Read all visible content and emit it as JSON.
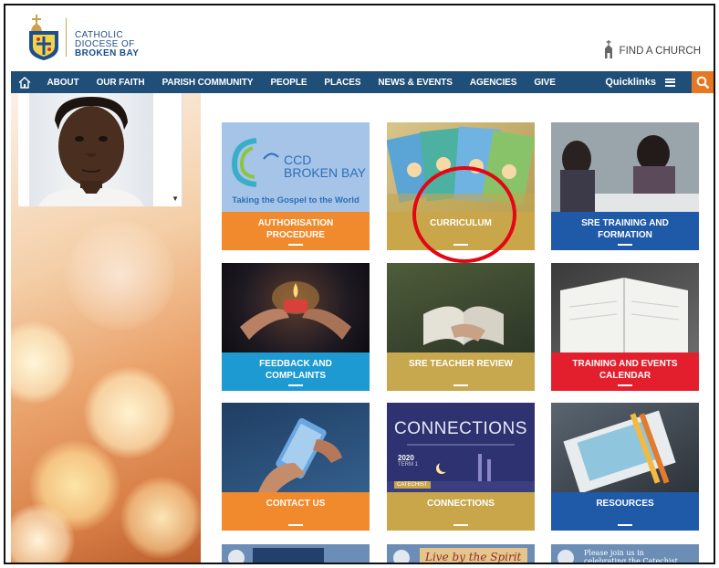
{
  "header": {
    "logo_line1": "CATHOLIC",
    "logo_line2": "DIOCESE OF",
    "logo_line3": "BROKEN BAY",
    "find_church": "FIND A CHURCH"
  },
  "nav": {
    "items": [
      "ABOUT",
      "OUR FAITH",
      "PARISH COMMUNITY",
      "PEOPLE",
      "PLACES",
      "NEWS & EVENTS",
      "AGENCIES",
      "GIVE"
    ],
    "quicklinks": "Quicklinks"
  },
  "tiles": [
    {
      "label": "AUTHORISATION PROCEDURE",
      "color": "#f08a2c"
    },
    {
      "label": "CURRICULUM",
      "color": "#c9a64a"
    },
    {
      "label": "SRE TRAINING AND FORMATION",
      "color": "#1e5aa8"
    },
    {
      "label": "FEEDBACK AND COMPLAINTS",
      "color": "#1d9ad1"
    },
    {
      "label": "SRE TEACHER REVIEW",
      "color": "#c8a84e"
    },
    {
      "label": "TRAINING AND EVENTS CALENDAR",
      "color": "#e41f2d"
    },
    {
      "label": "CONTACT US",
      "color": "#f08a2c"
    },
    {
      "label": "CONNECTIONS",
      "color": "#c9a64a"
    },
    {
      "label": "RESOURCES",
      "color": "#1e5aa8"
    }
  ],
  "tile_images": {
    "ccd_title_1": "CCD",
    "ccd_title_2": "BROKEN BAY",
    "ccd_tagline": "Taking the Gospel to the World",
    "connections_title": "CONNECTIONS",
    "connections_year": "2020",
    "connections_sub": "TERM 1",
    "connections_badge": "CATECHIST",
    "banner_middle": "Live by the Spirit",
    "banner_right_1": "Please join us in",
    "banner_right_2": "celebrating the Catechist Mission"
  },
  "colors": {
    "nav_bg": "#1f4e79",
    "search_bg": "#e87722",
    "highlight_circle": "#e30613",
    "logo_text": "#1e4f8c"
  }
}
